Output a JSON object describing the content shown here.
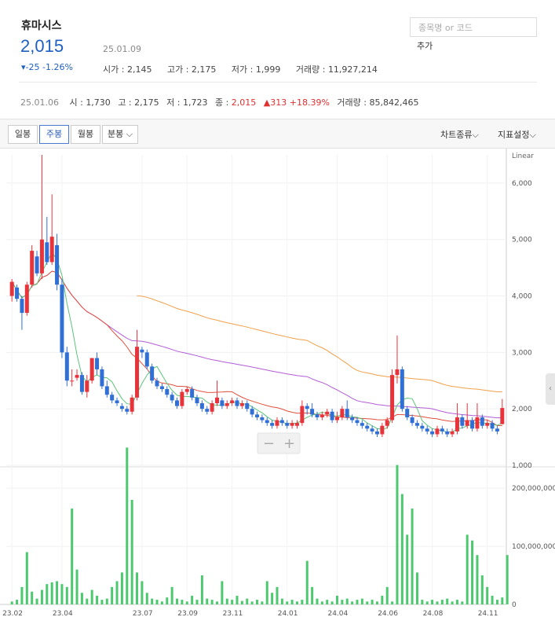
{
  "stock": {
    "name": "휴마시스",
    "price": "2,015",
    "change": "▾-25 -1.26%",
    "date": "25.01.09",
    "open_label": "시가",
    "open": "2,145",
    "high_label": "고가",
    "high": "2,175",
    "low_label": "저가",
    "low": "1,999",
    "volume_label": "거래량",
    "volume": "11,927,214"
  },
  "search": {
    "placeholder": "종목명 or 코드",
    "add_label": "추가"
  },
  "weekly": {
    "date": "25.01.06",
    "open_label": "시",
    "open": "1,730",
    "high_label": "고",
    "high": "2,175",
    "low_label": "저",
    "low": "1,723",
    "close_label": "종",
    "close": "2,015",
    "change": "▲313 +18.39%",
    "volume_label": "거래량",
    "volume": "85,842,465"
  },
  "tabs": [
    {
      "label": "일봉",
      "active": false
    },
    {
      "label": "주봉",
      "active": true
    },
    {
      "label": "월봉",
      "active": false
    },
    {
      "label": "분봉 ⌵",
      "active": false
    }
  ],
  "tools": {
    "chart_type": "차트종류⌵",
    "indicator": "지표설정⌵"
  },
  "zoom": {
    "minus": "−",
    "plus": "+"
  },
  "colors": {
    "up": "#e8333a",
    "down": "#2f6fd6",
    "volume": "#4cc96f",
    "ma5": "#5cc37a",
    "ma20": "#e0503c",
    "ma60": "#b35cd6",
    "ma120": "#f0a04a"
  },
  "chart_data": {
    "type": "candlestick",
    "price_scale": "Linear",
    "x_ticks": [
      "23.02",
      "23.04",
      "23.07",
      "23.09",
      "23.11",
      "24.01",
      "24.04",
      "24.06",
      "24.08",
      "24.11"
    ],
    "y_ticks": [
      "1,000",
      "2,000",
      "3,000",
      "4,000",
      "5,000",
      "6,000"
    ],
    "ylim": [
      1000,
      6500
    ],
    "volume_ticks": [
      "0",
      "100,000,000",
      "200,000,000"
    ],
    "volume_ylim": [
      0,
      230000000
    ],
    "candles": [
      [
        4000,
        4250,
        4300,
        3900
      ],
      [
        4150,
        3950,
        4200,
        3900
      ],
      [
        3950,
        3700,
        4000,
        3400
      ],
      [
        3700,
        4200,
        4250,
        3650
      ],
      [
        4200,
        4800,
        4900,
        4150
      ],
      [
        4700,
        4400,
        4800,
        4350
      ],
      [
        4400,
        5000,
        6500,
        4300
      ],
      [
        4950,
        4600,
        5400,
        4550
      ],
      [
        4600,
        5050,
        5800,
        4550
      ],
      [
        4900,
        4200,
        5100,
        4100
      ],
      [
        4200,
        3000,
        4300,
        2900
      ],
      [
        3000,
        2500,
        3100,
        2400
      ],
      [
        2500,
        2500,
        2700,
        2400
      ],
      [
        2550,
        2600,
        2700,
        2500
      ],
      [
        2600,
        2300,
        2650,
        2250
      ],
      [
        2300,
        2500,
        2600,
        2200
      ],
      [
        2500,
        2900,
        2900,
        2450
      ],
      [
        2900,
        2700,
        3000,
        2600
      ],
      [
        2700,
        2400,
        2750,
        2350
      ],
      [
        2400,
        2250,
        2500,
        2200
      ],
      [
        2250,
        2150,
        2300,
        2100
      ],
      [
        2150,
        2100,
        2200,
        2050
      ],
      [
        2050,
        2000,
        2100,
        1950
      ],
      [
        2000,
        1950,
        2050,
        1900
      ],
      [
        1950,
        2200,
        2250,
        1900
      ],
      [
        2200,
        3100,
        3400,
        2150
      ],
      [
        3050,
        3000,
        3100,
        2900
      ],
      [
        3000,
        2750,
        3050,
        2700
      ],
      [
        2750,
        2500,
        2800,
        2450
      ],
      [
        2500,
        2400,
        2550,
        2350
      ],
      [
        2400,
        2350,
        2450,
        2300
      ],
      [
        2350,
        2250,
        2400,
        2200
      ],
      [
        2250,
        2150,
        2300,
        2100
      ],
      [
        2150,
        2050,
        2200,
        2000
      ],
      [
        2050,
        2300,
        2350,
        2000
      ],
      [
        2300,
        2350,
        2400,
        2250
      ],
      [
        2350,
        2200,
        2400,
        2150
      ],
      [
        2200,
        2100,
        2250,
        2050
      ],
      [
        2100,
        2000,
        2150,
        1950
      ],
      [
        2000,
        1950,
        2050,
        1900
      ],
      [
        1950,
        2100,
        2150,
        1900
      ],
      [
        2100,
        2200,
        2500,
        2050
      ],
      [
        2150,
        2050,
        2200,
        2000
      ],
      [
        2050,
        2100,
        2150,
        2000
      ],
      [
        2100,
        2150,
        2200,
        2050
      ],
      [
        2150,
        2050,
        2200,
        2000
      ],
      [
        2050,
        2100,
        2150,
        2000
      ],
      [
        2100,
        2000,
        2150,
        1950
      ],
      [
        2000,
        1900,
        2050,
        1850
      ],
      [
        1900,
        1850,
        1950,
        1800
      ],
      [
        1850,
        1800,
        1900,
        1750
      ],
      [
        1800,
        1750,
        1850,
        1700
      ],
      [
        1750,
        1700,
        1800,
        1650
      ],
      [
        1700,
        1800,
        1850,
        1650
      ],
      [
        1800,
        1750,
        1850,
        1700
      ],
      [
        1750,
        1700,
        1800,
        1650
      ],
      [
        1700,
        1750,
        1800,
        1650
      ],
      [
        1700,
        1750,
        1800,
        1650
      ],
      [
        1750,
        2050,
        2150,
        1700
      ],
      [
        2050,
        2000,
        2100,
        1900
      ],
      [
        2000,
        1900,
        2100,
        1850
      ],
      [
        1900,
        1850,
        1950,
        1800
      ],
      [
        1850,
        1900,
        1950,
        1800
      ],
      [
        1900,
        1950,
        2000,
        1850
      ],
      [
        1950,
        1800,
        2000,
        1750
      ],
      [
        1800,
        1850,
        1950,
        1750
      ],
      [
        1850,
        2000,
        2050,
        1800
      ],
      [
        2000,
        1850,
        2150,
        1800
      ],
      [
        1850,
        1800,
        1900,
        1750
      ],
      [
        1800,
        1750,
        1850,
        1700
      ],
      [
        1750,
        1700,
        1800,
        1650
      ],
      [
        1700,
        1650,
        1750,
        1600
      ],
      [
        1650,
        1600,
        1700,
        1550
      ],
      [
        1600,
        1550,
        1650,
        1500
      ],
      [
        1550,
        1700,
        1750,
        1500
      ],
      [
        1700,
        1800,
        1850,
        1650
      ],
      [
        1800,
        2600,
        2700,
        1750
      ],
      [
        2600,
        2700,
        3300,
        2450
      ],
      [
        2700,
        2000,
        2750,
        1950
      ],
      [
        2000,
        1850,
        2050,
        1800
      ],
      [
        1850,
        1750,
        1900,
        1700
      ],
      [
        1750,
        1700,
        1800,
        1650
      ],
      [
        1700,
        1650,
        1750,
        1600
      ],
      [
        1650,
        1600,
        1700,
        1550
      ],
      [
        1600,
        1550,
        1650,
        1500
      ],
      [
        1550,
        1650,
        1700,
        1500
      ],
      [
        1650,
        1600,
        1700,
        1550
      ],
      [
        1600,
        1550,
        1650,
        1500
      ],
      [
        1550,
        1600,
        1650,
        1500
      ],
      [
        1600,
        1850,
        2100,
        1550
      ],
      [
        1850,
        1700,
        1900,
        1650
      ],
      [
        1700,
        1800,
        2100,
        1650
      ],
      [
        1800,
        1650,
        1850,
        1600
      ],
      [
        1650,
        1850,
        2100,
        1600
      ],
      [
        1850,
        1700,
        1900,
        1650
      ],
      [
        1700,
        1750,
        1800,
        1650
      ],
      [
        1750,
        1650,
        1800,
        1600
      ],
      [
        1650,
        1600,
        1700,
        1550
      ],
      [
        1730,
        2015,
        2175,
        1723
      ]
    ],
    "volume": [
      5,
      8,
      30,
      90,
      22,
      10,
      25,
      35,
      38,
      40,
      35,
      30,
      165,
      60,
      20,
      10,
      25,
      15,
      8,
      10,
      30,
      40,
      55,
      270,
      180,
      55,
      40,
      20,
      10,
      8,
      5,
      12,
      30,
      10,
      8,
      5,
      15,
      8,
      50,
      10,
      8,
      5,
      40,
      10,
      8,
      15,
      6,
      10,
      5,
      8,
      5,
      40,
      20,
      30,
      10,
      5,
      8,
      5,
      8,
      75,
      30,
      10,
      5,
      8,
      5,
      15,
      8,
      10,
      5,
      8,
      10,
      5,
      8,
      5,
      15,
      30,
      5,
      240,
      190,
      120,
      165,
      55,
      8,
      5,
      8,
      5,
      8,
      10,
      5,
      8,
      5,
      120,
      110,
      85,
      50,
      30,
      15,
      8,
      12,
      85
    ]
  }
}
